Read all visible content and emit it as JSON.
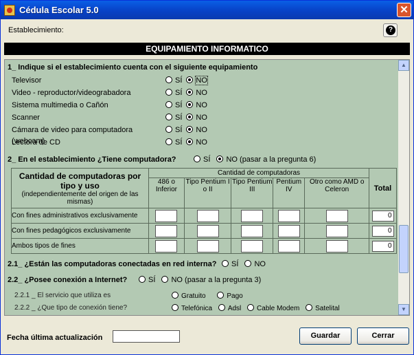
{
  "window": {
    "title": "Cédula Escolar 5.0",
    "close_glyph": "✕"
  },
  "header": {
    "establecimiento_label": "Establecimiento:",
    "help_glyph": "?"
  },
  "section_title": "EQUIPAMIENTO INFORMATICO",
  "q1": {
    "title": "1_ Indique si el establecimiento cuenta con el siguiente equipamiento",
    "items": [
      {
        "label": "Televisor",
        "yes": "SÍ",
        "no": "NO",
        "selected": "no"
      },
      {
        "label": "Video - reproductor/videograbadora",
        "yes": "SÍ",
        "no": "NO",
        "selected": "no"
      },
      {
        "label": "Sistema multimedia o Cañón",
        "yes": "SÍ",
        "no": "NO",
        "selected": "no"
      },
      {
        "label": "Scanner",
        "yes": "SÍ",
        "no": "NO",
        "selected": "no"
      },
      {
        "label": "Cámara de video para computadora (webcam)",
        "yes": "SÍ",
        "no": "NO",
        "selected": "no"
      },
      {
        "label": "Lectora de CD",
        "yes": "SÍ",
        "no": "NO",
        "selected": "no"
      }
    ]
  },
  "q2": {
    "title": "2_ En el establecimiento ¿Tiene computadora?",
    "yes": "SÍ",
    "no": "NO (pasar a la pregunta 6)",
    "selected": "no"
  },
  "table": {
    "head_title": "Cantidad de computadoras por tipo y uso",
    "head_sub": "(independientemente del origen de las mismas)",
    "group_head": "Cantidad de computadoras",
    "columns": [
      "486 o Inferior",
      "Tipo Pentium I o II",
      "Tipo Pentium III",
      "Pentium IV",
      "Otro como AMD o Celeron"
    ],
    "total_label": "Total",
    "rows": [
      {
        "label": "Con fines administrativos exclusivamente",
        "total": "0"
      },
      {
        "label": "Con fines pedagógicos exclusivamente",
        "total": "0"
      },
      {
        "label": "Ambos tipos de fines",
        "total": "0"
      }
    ]
  },
  "q21": {
    "title": "2.1_ ¿Están las computadoras conectadas en red interna?",
    "yes": "SÍ",
    "no": "NO"
  },
  "q22": {
    "title": "2.2_ ¿Posee conexión a Internet?",
    "yes": "SÍ",
    "no": "NO (pasar a la pregunta 3)"
  },
  "q221": {
    "label": "2.2.1 _ El servicio que utiliza es",
    "options": [
      "Gratuito",
      "Pago"
    ]
  },
  "q222": {
    "label": "2.2.2 _ ¿Que tipo de conexión tiene?",
    "options": [
      "Telefónica",
      "Adsl",
      "Cable Modem",
      "Satelital"
    ]
  },
  "footer": {
    "fecha_label": "Fecha última actualización",
    "fecha_value": "",
    "guardar_label": "Guardar",
    "cerrar_label": "Cerrar"
  },
  "colors": {
    "title_bar": "#0842c6",
    "pane_bg": "#b3c9b3",
    "window_bg": "#ece9d8"
  }
}
